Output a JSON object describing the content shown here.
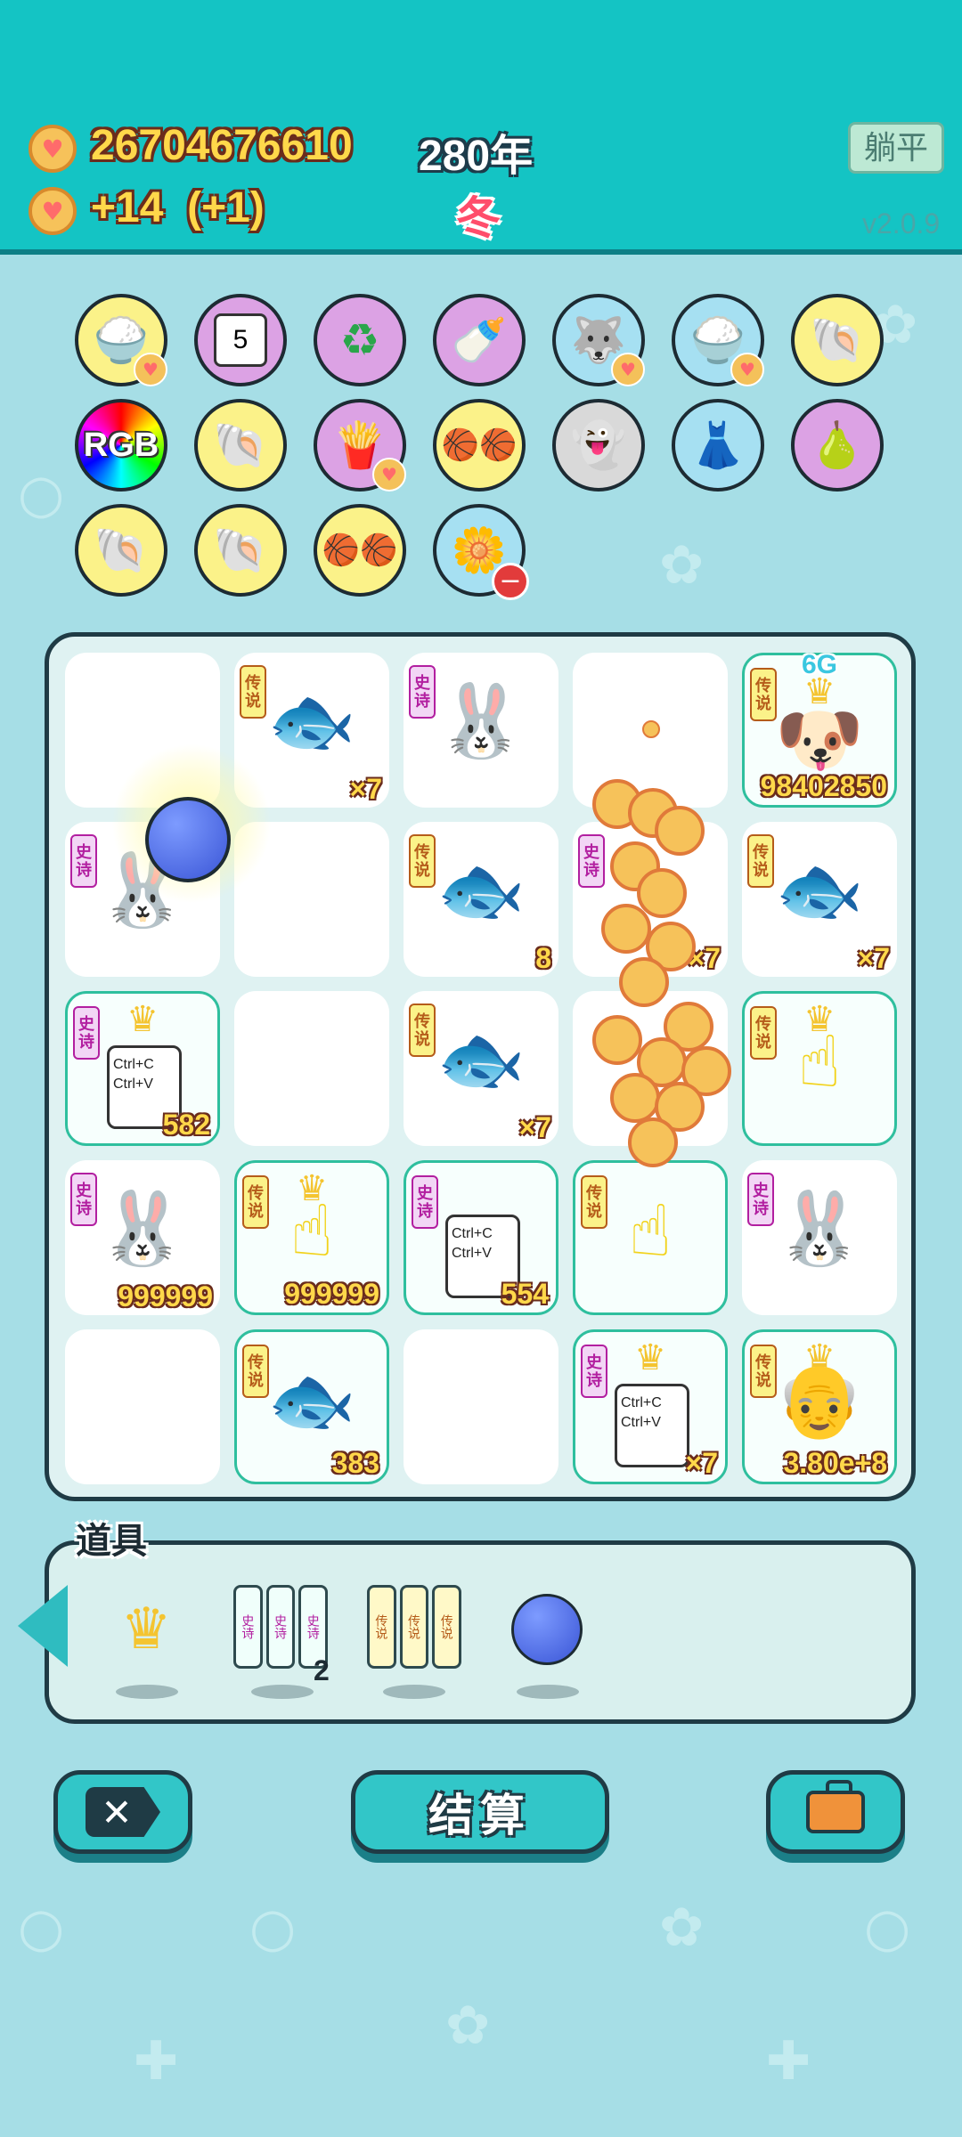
{
  "header": {
    "coins": "26704676610",
    "income": "+14  (+1)",
    "year": "280年",
    "season": "冬",
    "lie_flat_button": "躺平",
    "version": "v2.0.9"
  },
  "collection": {
    "rgb_label": "RGB",
    "calendar_day": "5"
  },
  "board": {
    "tags": {
      "legend": "传说",
      "epic": "史诗"
    },
    "cells": {
      "r0c1_count": "×7",
      "r0c4_badge": "6G",
      "r0c4_count": "98402850",
      "r1c2_count": "8",
      "r1c3_count": "×7",
      "r1c4_count": "×7",
      "r2c0_card": "Ctrl+C\nCtrl+V",
      "r2c0_count": "582",
      "r2c2_count": "×7",
      "r3c0_count": "999999",
      "r3c1_count": "999999",
      "r3c2_card": "Ctrl+C\nCtrl+V",
      "r3c2_count": "554",
      "r4c1_count": "383",
      "r4c3_card": "Ctrl+C\nCtrl+V",
      "r4c3_count": "×7",
      "r4c4_count": "3.80e+8"
    }
  },
  "tools": {
    "label": "道具",
    "scroll_count": "2"
  },
  "buttons": {
    "settle": "结算"
  },
  "colors": {
    "header_bg": "#14c4c4",
    "page_bg": "#a6dee6",
    "coin_text": "#ffd84a",
    "season": "#ff4d6b"
  }
}
